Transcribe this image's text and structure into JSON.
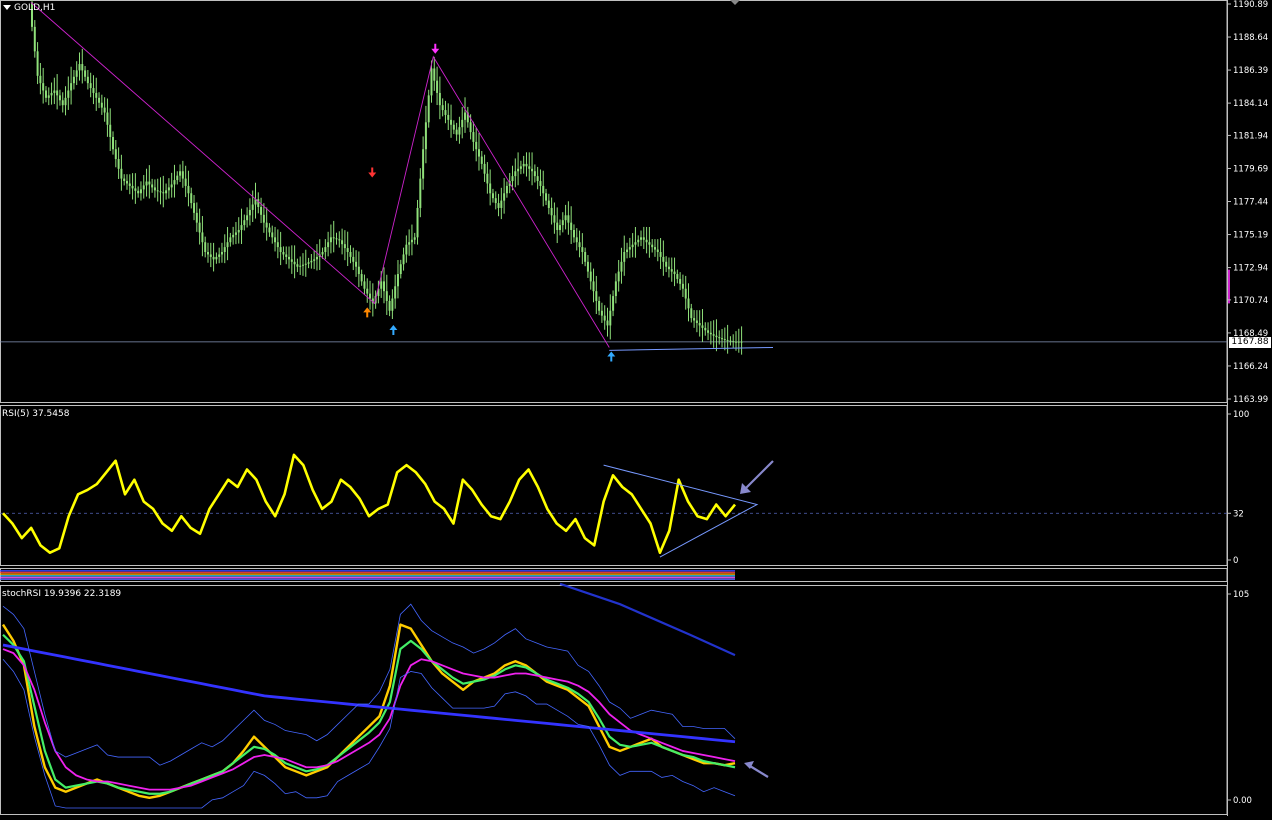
{
  "main_panel": {
    "symbol_label": "GOLD,H1",
    "current_price_label": "1167.88",
    "price_axis_labels": [
      "1190.89",
      "1188.64",
      "1186.39",
      "1184.14",
      "1181.94",
      "1179.69",
      "1177.44",
      "1175.19",
      "1172.94",
      "1170.74",
      "1168.49",
      "1166.24",
      "1163.99"
    ]
  },
  "rsi_panel": {
    "label": "RSI(5) 37.5458",
    "axis_labels": [
      "100",
      "32",
      "0"
    ]
  },
  "stoch_panel": {
    "label": "stochRSI 19.9396 22.3189",
    "axis_labels": [
      "105",
      "0.00"
    ]
  },
  "colors": {
    "background": "#000000",
    "candles": "#8fe07a",
    "zigzag": "#cc22cc",
    "rsi": "#ffff00",
    "stoch_k": "#ffcc00",
    "stoch_d": "#44ee66",
    "stoch_signal": "#ee22ee",
    "slow_ma": "#3333ff",
    "bands": "#4466ff",
    "arrow_up_orange": "#ff8800",
    "arrow_up_blue": "#33aaff",
    "arrow_down_red": "#ff3333",
    "arrow_down_magenta": "#ff33ff",
    "trendline": "#7799ff",
    "annotation_arrow": "#8888cc"
  },
  "chart_data": [
    {
      "type": "line",
      "series": [
        {
          "values": [
            1191.0,
            1186.0,
            1184.5,
            1185.0,
            1184.0,
            1185.5,
            1186.8,
            1185.5,
            1184.5,
            1183.5,
            1181.0,
            1179.0,
            1178.5,
            1178.0,
            1178.8,
            1178.2,
            1178.0,
            1178.6,
            1179.5,
            1178.0,
            1176.0,
            1174.0,
            1173.5,
            1174.0,
            1175.0,
            1175.5,
            1176.5,
            1177.6,
            1176.0,
            1175.0,
            1174.0,
            1173.5,
            1173.0,
            1173.2,
            1173.5,
            1174.0,
            1175.0,
            1174.8,
            1174.0,
            1173.0,
            1171.5,
            1170.5,
            1172.0,
            1170.0,
            1172.5,
            1174.5,
            1175.0,
            1181.0,
            1186.5,
            1184.0,
            1183.0,
            1182.0,
            1183.5,
            1181.5,
            1180.0,
            1178.0,
            1177.0,
            1178.5,
            1179.5,
            1180.0,
            1179.5,
            1178.5,
            1177.0,
            1175.5,
            1176.5,
            1175.0,
            1174.0,
            1172.0,
            1170.0,
            1169.0,
            1172.0,
            1174.0,
            1174.5,
            1175.0,
            1174.5,
            1174.0,
            1173.0,
            1172.5,
            1171.5,
            1169.5,
            1169.0,
            1168.5,
            1168.2,
            1168.0,
            1167.9
          ]
        }
      ],
      "ylim": [
        1163.99,
        1190.89
      ]
    },
    {
      "type": "line",
      "series": [
        {
          "values": [
            32,
            25,
            15,
            22,
            10,
            5,
            8,
            30,
            45,
            48,
            52,
            60,
            68,
            45,
            55,
            40,
            35,
            25,
            20,
            30,
            22,
            18,
            35,
            45,
            55,
            50,
            62,
            55,
            40,
            30,
            45,
            72,
            65,
            48,
            35,
            40,
            55,
            50,
            42,
            30,
            35,
            38,
            60,
            65,
            60,
            52,
            40,
            35,
            25,
            55,
            48,
            38,
            30,
            28,
            40,
            55,
            62,
            50,
            35,
            25,
            20,
            28,
            15,
            10,
            40,
            58,
            50,
            45,
            35,
            25,
            5,
            20,
            55,
            40,
            30,
            28,
            38,
            30,
            38
          ]
        }
      ],
      "ylim": [
        0,
        100
      ]
    },
    {
      "type": "line",
      "series": [
        {
          "values": [
            90,
            82,
            70,
            40,
            20,
            10,
            8,
            10,
            12,
            14,
            12,
            10,
            8,
            6,
            5,
            6,
            8,
            10,
            12,
            14,
            16,
            18,
            22,
            28,
            35,
            30,
            25,
            20,
            18,
            16,
            18,
            20,
            25,
            30,
            35,
            40,
            45,
            60,
            90,
            88,
            80,
            72,
            66,
            62,
            58,
            62,
            64,
            66,
            70,
            72,
            70,
            66,
            62,
            60,
            58,
            54,
            50,
            40,
            30,
            28,
            30,
            32,
            34,
            30,
            28,
            26,
            24,
            22,
            22,
            21,
            22
          ]
        },
        {
          "values": [
            85,
            80,
            72,
            50,
            28,
            14,
            10,
            11,
            12,
            13,
            12,
            10,
            9,
            8,
            7,
            7,
            8,
            10,
            12,
            14,
            16,
            18,
            22,
            26,
            30,
            29,
            26,
            22,
            20,
            18,
            19,
            21,
            25,
            29,
            33,
            37,
            42,
            52,
            78,
            82,
            78,
            72,
            68,
            64,
            61,
            62,
            63,
            65,
            68,
            70,
            69,
            66,
            63,
            61,
            59,
            56,
            52,
            44,
            35,
            31,
            30,
            31,
            32,
            30,
            28,
            26,
            25,
            23,
            22,
            21,
            20
          ]
        },
        {
          "values": [
            78,
            76,
            70,
            58,
            42,
            28,
            20,
            16,
            14,
            13,
            13,
            12,
            11,
            10,
            9,
            9,
            9,
            10,
            11,
            13,
            15,
            17,
            19,
            22,
            25,
            26,
            25,
            24,
            22,
            20,
            20,
            21,
            23,
            26,
            29,
            32,
            36,
            44,
            60,
            70,
            73,
            72,
            70,
            68,
            66,
            65,
            64,
            64,
            65,
            66,
            66,
            65,
            64,
            63,
            62,
            60,
            57,
            52,
            46,
            42,
            38,
            36,
            34,
            32,
            30,
            28,
            27,
            26,
            25,
            24,
            23
          ]
        },
        {
          "values": [
            80,
            79,
            78,
            77,
            76,
            75,
            74,
            73,
            72,
            71,
            70,
            69,
            68,
            67,
            66,
            65,
            64,
            63,
            62,
            61,
            60,
            59,
            58,
            57,
            56,
            55,
            54.5,
            54,
            53.5,
            53,
            52.5,
            52,
            51.5,
            51,
            50.5,
            50,
            49.5,
            49,
            48.5,
            48,
            47.5,
            47,
            46.5,
            46,
            45.5,
            45,
            44.5,
            44,
            43.5,
            43,
            42.5,
            42,
            41.5,
            41,
            40.5,
            40,
            39.5,
            39,
            38.5,
            38,
            37.5,
            37,
            36.5,
            36,
            35.5,
            35,
            34.5,
            34,
            33.5,
            33,
            32.5
          ]
        }
      ],
      "ylim": [
        0,
        105
      ]
    }
  ]
}
